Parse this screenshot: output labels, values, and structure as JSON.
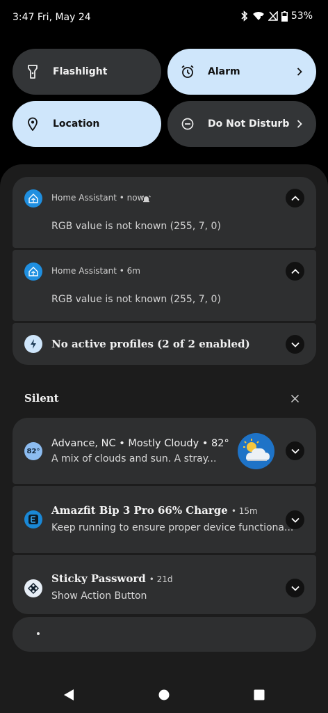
{
  "status": {
    "time_date": "3:47 Fri, May 24",
    "battery": "53%"
  },
  "quick_tiles": [
    {
      "label": "Flashlight",
      "icon": "flashlight-icon",
      "active": false
    },
    {
      "label": "Alarm",
      "icon": "alarm-icon",
      "active": true
    },
    {
      "label": "Location",
      "icon": "location-icon",
      "active": true
    },
    {
      "label": "Do Not Disturb",
      "icon": "dnd-icon",
      "active": false
    }
  ],
  "notifications": [
    {
      "app": "Home Assistant • now",
      "body": "RGB value is not known (255, 7, 0)"
    },
    {
      "app": "Home Assistant • 6m",
      "body": "RGB value is not known (255, 7, 0)"
    }
  ],
  "profiles": {
    "title": "No active profiles (2 of 2 enabled)"
  },
  "silent": {
    "header": "Silent",
    "weather": {
      "badge": "82°",
      "title": "Advance, NC • Mostly Cloudy • 82°",
      "body": "A mix of clouds and sun. A stray..."
    },
    "amazfit": {
      "title": "Amazfit Bip 3 Pro 66% Charge",
      "time": "• 15m",
      "body": "Keep running to ensure proper device functiona..."
    },
    "sticky": {
      "title": "Sticky Password",
      "time": "• 21d",
      "body": "Show Action Button"
    }
  },
  "colors": {
    "accent_light": "#cfe6fb",
    "tile_dark": "#333537",
    "card": "#2e2f30",
    "shade": "#1c1c1c"
  }
}
